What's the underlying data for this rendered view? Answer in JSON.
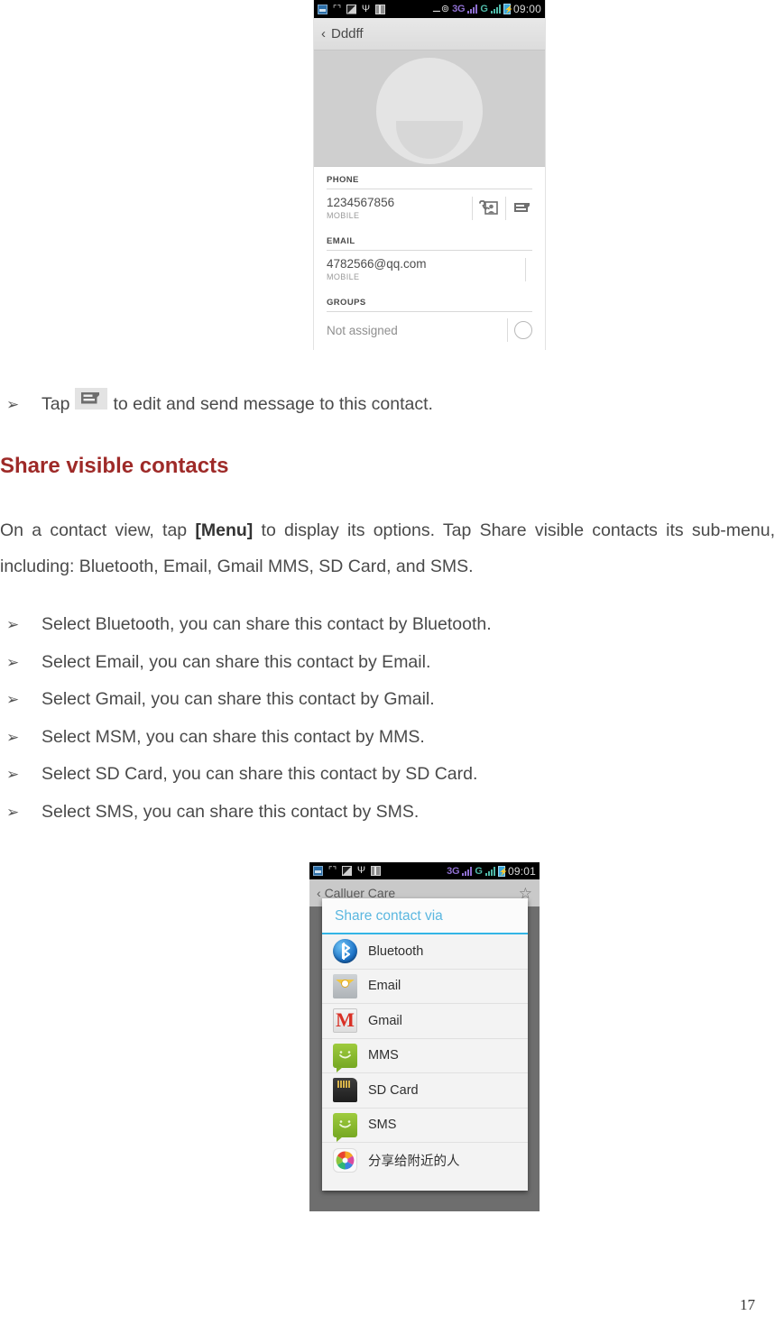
{
  "document": {
    "page_number": "17",
    "heading": "Share visible contacts",
    "tap_line": {
      "bullet": "➢",
      "text_before": "Tap",
      "icon": "message-icon",
      "text_after": "to edit and send message to this contact."
    },
    "paragraph": {
      "part1": "On a contact view, tap ",
      "menu": "[Menu]",
      "part2": " to display its options. Tap Share visible contacts its sub-menu, including: Bluetooth, Email, Gmail MMS, SD Card, and SMS."
    },
    "bullets": [
      "Select Bluetooth, you can share this contact by Bluetooth.",
      "Select Email, you can share this contact by Email.",
      "Select Gmail, you can share this contact by Gmail.",
      "Select MSM, you can share this contact by MMS.",
      "Select SD Card, you can share this contact by SD Card.",
      "Select SMS, you can share this contact by SMS."
    ],
    "bullet_mark": "➢"
  },
  "screenshot_contact": {
    "statusbar": {
      "icons_left": [
        "notification-icon",
        "missed-call-icon",
        "screenshot-icon",
        "usb-icon",
        "sim-icon"
      ],
      "sync_icon": "sync-icon",
      "network_3g": "3G",
      "network_g": "G",
      "battery_icon": "battery-icon",
      "clock": "09:00"
    },
    "actionbar": {
      "back": "‹",
      "title": "Dddff"
    },
    "photo_alt": "default-contact-avatar",
    "sections": [
      {
        "label": "PHONE",
        "value": "1234567856",
        "type": "MOBILE",
        "actions": [
          "video-call-icon",
          "message-icon"
        ]
      },
      {
        "label": "EMAIL",
        "value": "4782566@qq.com",
        "type": "MOBILE",
        "actions": []
      },
      {
        "label": "GROUPS",
        "value": "Not assigned",
        "type": "",
        "actions": [
          "expand-icon"
        ]
      }
    ]
  },
  "screenshot_share": {
    "statusbar": {
      "network_3g": "3G",
      "network_g": "G",
      "clock": "09:01"
    },
    "actionbar": {
      "back": "‹",
      "title": "Calluer Care",
      "star_icon": "star-icon"
    },
    "dialog": {
      "title": "Share contact via",
      "items": [
        {
          "label": "Bluetooth",
          "icon": "bluetooth-icon"
        },
        {
          "label": "Email",
          "icon": "email-icon"
        },
        {
          "label": "Gmail",
          "icon": "gmail-icon"
        },
        {
          "label": "MMS",
          "icon": "mms-icon"
        },
        {
          "label": "SD Card",
          "icon": "sd-card-icon"
        },
        {
          "label": "SMS",
          "icon": "sms-icon"
        },
        {
          "label": "分享给附近的人",
          "icon": "nearby-share-icon"
        }
      ]
    }
  },
  "colors": {
    "heading": "#9e2a28",
    "dialog_accent": "#33b5e5",
    "body_text": "#4a4a4a"
  }
}
